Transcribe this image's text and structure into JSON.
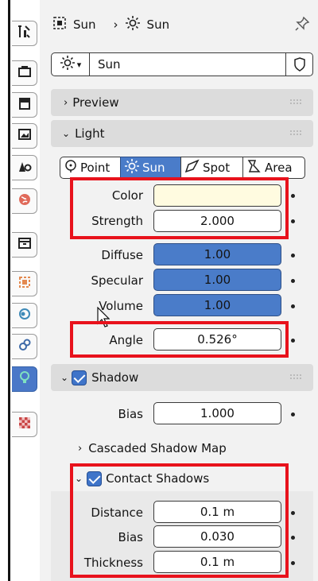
{
  "header": {
    "object_name": "Sun",
    "data_name": "Sun"
  },
  "datablock": {
    "name": "Sun"
  },
  "sections": {
    "preview": "Preview",
    "light": "Light",
    "shadow": "Shadow",
    "cascaded": "Cascaded Shadow Map",
    "contact": "Contact Shadows"
  },
  "light_types": [
    {
      "label": "Point",
      "icon": "point-light-icon",
      "active": false
    },
    {
      "label": "Sun",
      "icon": "sun-light-icon",
      "active": true
    },
    {
      "label": "Spot",
      "icon": "spot-light-icon",
      "active": false
    },
    {
      "label": "Area",
      "icon": "area-light-icon",
      "active": false
    }
  ],
  "light": {
    "color_label": "Color",
    "color_value": "#fffbe0",
    "strength_label": "Strength",
    "strength": "2.000",
    "diffuse_label": "Diffuse",
    "diffuse": "1.00",
    "specular_label": "Specular",
    "specular": "1.00",
    "volume_label": "Volume",
    "volume": "1.00",
    "angle_label": "Angle",
    "angle": "0.526°"
  },
  "shadow": {
    "bias_label": "Bias",
    "bias": "1.000"
  },
  "contact": {
    "distance_label": "Distance",
    "distance": "0.1 m",
    "bias_label": "Bias",
    "bias": "0.030",
    "thickness_label": "Thickness",
    "thickness": "0.1 m"
  },
  "colors": {
    "accent": "#4a7cc9",
    "highlight": "#e8121c"
  }
}
